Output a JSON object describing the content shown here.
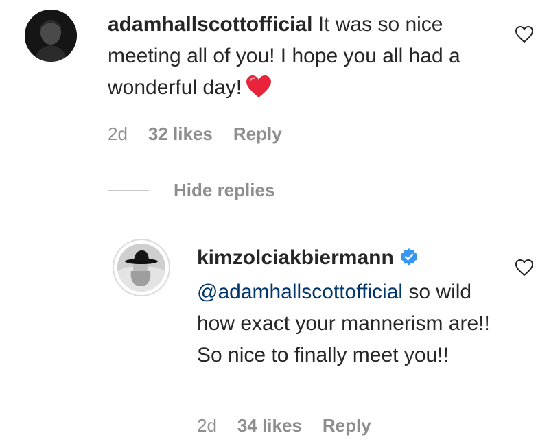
{
  "comment": {
    "username": "adamhallscottofficial",
    "text": "It was so nice meeting all of you! I hope you all had a wonderful day!",
    "emoji": "red-heart",
    "age": "2d",
    "likes": "32 likes",
    "reply_label": "Reply",
    "avatar_icon": "profile-photo-dark"
  },
  "thread": {
    "hide_replies_label": "Hide replies"
  },
  "reply": {
    "username": "kimzolciakbiermann",
    "verified": true,
    "mention": "@adamhallscottofficial",
    "text": "so wild how exact your mannerism are!! So nice to finally meet you!!",
    "age": "2d",
    "likes": "34 likes",
    "reply_label": "Reply",
    "avatar_icon": "profile-photo-hat"
  },
  "colors": {
    "text": "#262626",
    "secondary": "#8e8e8e",
    "mention": "#00376b",
    "verified": "#3897f0",
    "heart": "#ed4956"
  }
}
